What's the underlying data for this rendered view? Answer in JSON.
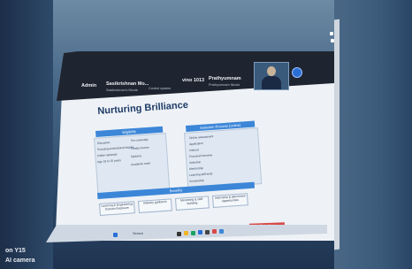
{
  "meeting": {
    "participant_1": "Admin",
    "participant_2": "Sasikrishnan Mo...",
    "participant_2_sub": "Sasikrishnan's Nicole",
    "participant_3": "Control system",
    "participant_4": "vino 1013",
    "participant_4_sub": "",
    "participant_5": "Prathyumnam",
    "participant_5_sub": "Prathyumnam Nicole",
    "self_label": "Sasikrishnan",
    "host_label": "Admin",
    "brand_color": "#2b6fd6"
  },
  "slide": {
    "title": "Nurturing Brilliance",
    "left_header": "Eligibility",
    "right_header": "Selection Process (online)",
    "left_items": [
      "Education",
      "Pursuing professional degree",
      "Indian nationals",
      "Age 18 to 25 years",
      "Pre-university",
      "Family income",
      "Diploma",
      "Academic merit"
    ],
    "right_items": [
      "Online assessment",
      "Application",
      "Interest",
      "Personal interview",
      "Selection",
      "Mentorship",
      "Learning skill tests",
      "Scholarship"
    ],
    "benefits_header": "Benefits",
    "benefits": [
      "Learning & Engineering Domain Exposure",
      "Industry guidance",
      "Mentoring & skill-building",
      "Internship & placement opportunities"
    ]
  },
  "taskbar": {
    "search_label": "Search",
    "chip_label": "Recording"
  },
  "watermark": {
    "line1": "on Y15",
    "line2": "AI camera"
  }
}
